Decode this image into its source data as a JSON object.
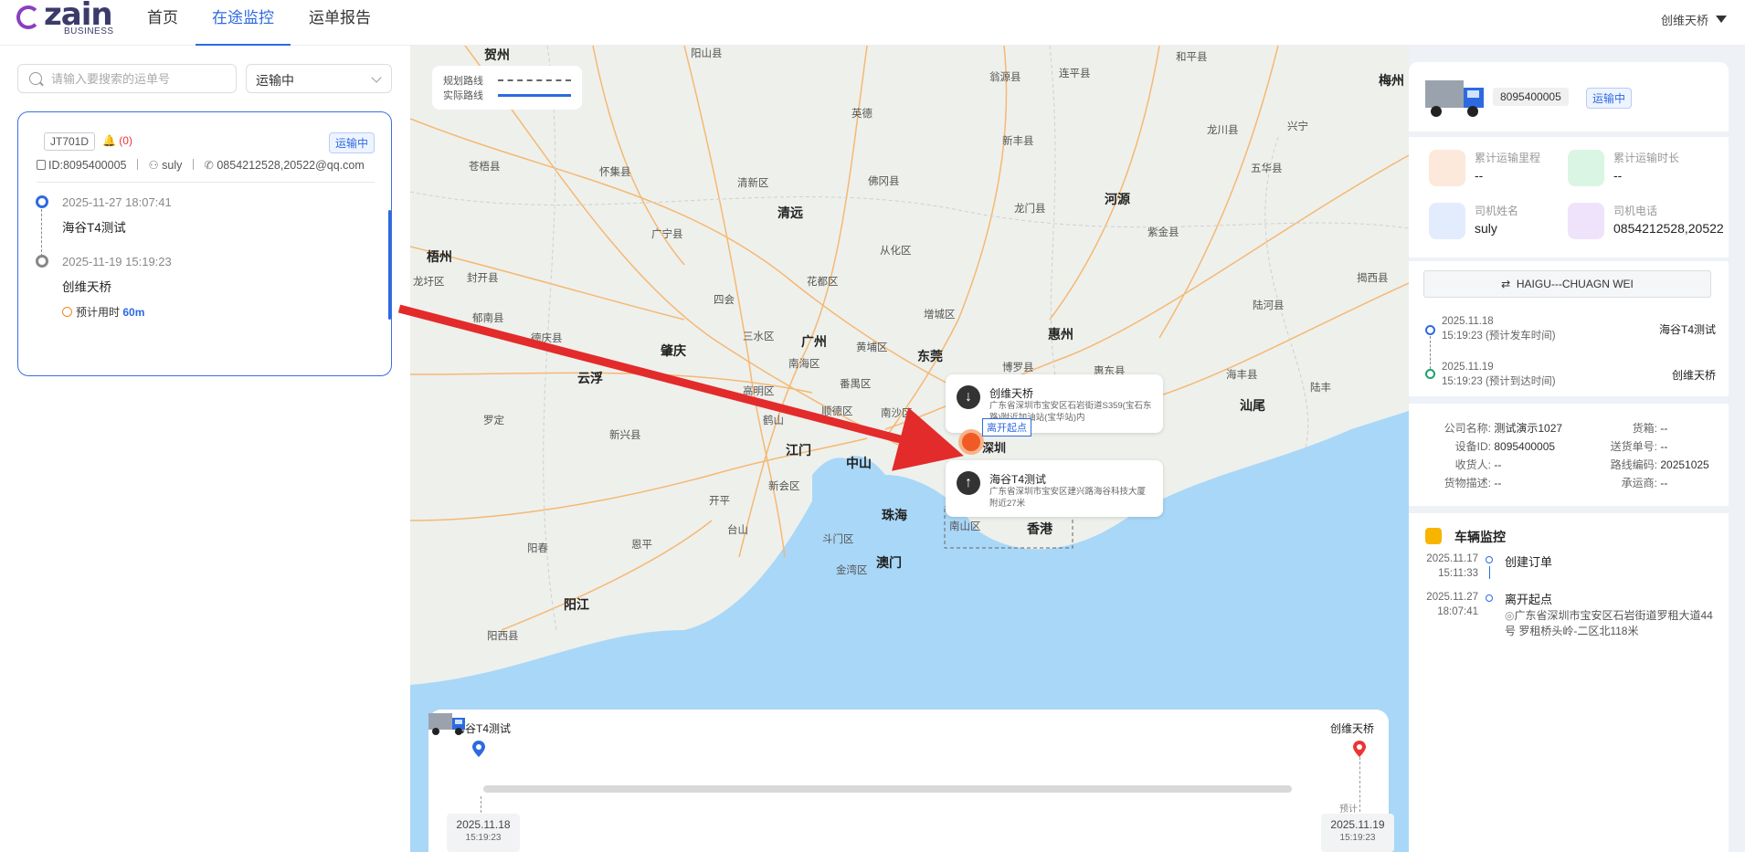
{
  "brand": {
    "logo_text": "zain",
    "logo_sub": "BUSINESS"
  },
  "nav": {
    "home": "首页",
    "monitor": "在途监控",
    "report": "运单报告"
  },
  "user": {
    "name": "创维天桥"
  },
  "search": {
    "placeholder": "请输入要搜索的运单号",
    "value": ""
  },
  "status_filter": {
    "selected": "运输中"
  },
  "order_card": {
    "plate": "JT701D",
    "alarm": "(0)",
    "status": "运输中",
    "id_label": "ID:8095400005",
    "driver": "suly",
    "phone": "0854212528,20522@qq.com",
    "start_time": "2025-11-27 18:07:41",
    "start_place": "海谷T4测试",
    "end_time": "2025-11-19 15:19:23",
    "end_place": "创维天桥",
    "eta_label": "预计用时",
    "eta_value": "60m"
  },
  "map": {
    "legend_planned": "规划路线",
    "legend_actual": "实际路线",
    "cities_big": [
      "贺州",
      "梧州",
      "云浮",
      "肇庆",
      "广州",
      "东莞",
      "惠州",
      "江门",
      "中山",
      "珠海",
      "澳门",
      "香港",
      "阳江",
      "河源",
      "清远",
      "汕尾",
      "梅州"
    ],
    "counties": [
      "阳山县",
      "翁源县",
      "连平县",
      "和平县",
      "英德",
      "新丰县",
      "龙川县",
      "兴宁",
      "苍梧县",
      "怀集县",
      "清新区",
      "佛冈县",
      "五华县",
      "广宁县",
      "龙门县",
      "紫金县",
      "龙圩区",
      "封开县",
      "从化区",
      "花都区",
      "四会",
      "增城区",
      "陆河县",
      "揭西县",
      "郁南县",
      "德庆县",
      "三水区",
      "黄埔区",
      "南海区",
      "番禺区",
      "博罗县",
      "惠东县",
      "海丰县",
      "陆丰",
      "罗定",
      "高明区",
      "鹤山",
      "顺德区",
      "南沙区",
      "新兴县",
      "新会区",
      "开平",
      "台山",
      "恩平",
      "斗门区",
      "金湾区",
      "阳春",
      "阳西县",
      "南山区",
      "深圳"
    ],
    "popup_end_title": "创维天桥",
    "popup_end_addr": "广东省深圳市宝安区石岩街道S359(宝石东路)附近加油站(宝华站)内",
    "popup_start_title": "海谷T4测试",
    "popup_start_addr": "广东省深圳市宝安区建兴路海谷科技大厦附近27米",
    "depart_label": "离开起点"
  },
  "timeline": {
    "start_name": "海谷T4测试",
    "end_name": "创维天桥",
    "start_date": "2025.11.18",
    "start_time": "15:19:23",
    "end_date": "2025.11.19",
    "end_time": "15:19:23",
    "pred_label": "预计",
    "progress": 0
  },
  "right": {
    "device_id": "8095400005",
    "status": "运输中",
    "mileage_label": "累计运输里程",
    "mileage_value": "--",
    "duration_label": "累计运输时长",
    "duration_value": "--",
    "driver_label": "司机姓名",
    "driver_value": "suly",
    "phone_label": "司机电话",
    "phone_value": "0854212528,20522",
    "route_name": "HAIGU---CHUAGN WEI",
    "depart_date": "2025.11.18",
    "depart_time": "15:19:23 (预计发车时间)",
    "depart_place": "海谷T4测试",
    "arrive_date": "2025.11.19",
    "arrive_time": "15:19:23 (预计到达时间)",
    "arrive_place": "创维天桥",
    "info": [
      {
        "k": "公司名称:",
        "v": "测试演示1027"
      },
      {
        "k": "货箱:",
        "v": "--"
      },
      {
        "k": "设备ID:",
        "v": "8095400005"
      },
      {
        "k": "送货单号:",
        "v": "--"
      },
      {
        "k": "收货人:",
        "v": "--"
      },
      {
        "k": "路线编码:",
        "v": "20251025"
      },
      {
        "k": "货物描述:",
        "v": "--"
      },
      {
        "k": "承运商:",
        "v": "--"
      }
    ],
    "monitor_title": "车辆监控",
    "events": [
      {
        "date": "2025.11.17",
        "time": "15:11:33",
        "title": "创建订单",
        "addr": ""
      },
      {
        "date": "2025.11.27",
        "time": "18:07:41",
        "title": "离开起点",
        "addr": "广东省深圳市宝安区石岩街道罗租大道44号 罗租桥头岭-二区北118米"
      }
    ]
  },
  "colors": {
    "accent": "#2d6ae0",
    "arrow": "#e32b2b",
    "water": "#a9d7f7",
    "land": "#eef0ec"
  }
}
